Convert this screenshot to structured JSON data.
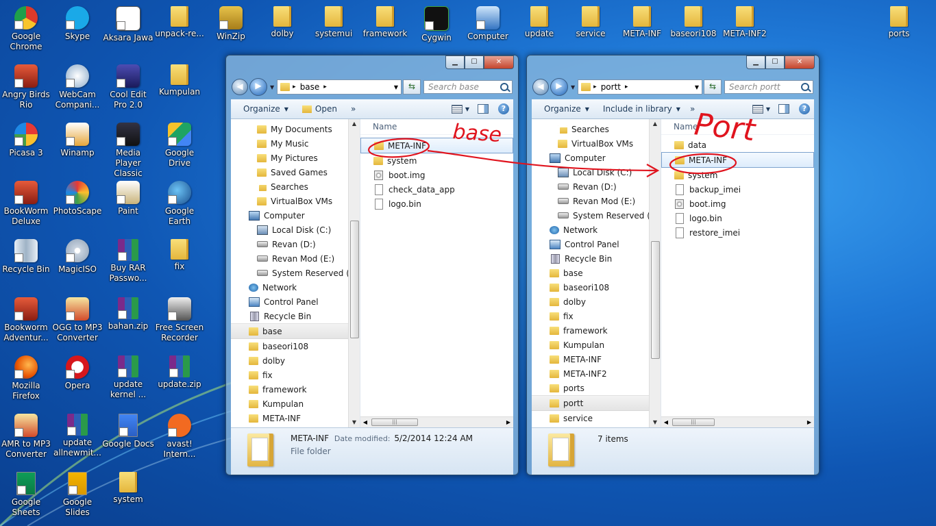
{
  "desktop_icons": [
    {
      "label": "Google Chrome",
      "icon": "chrome-icon"
    },
    {
      "label": "Skype",
      "icon": "skype-icon"
    },
    {
      "label": "Aksara Jawa",
      "icon": "app-icon"
    },
    {
      "label": "unpack-re...",
      "icon": "folder-icon"
    },
    {
      "label": "WinZip",
      "icon": "winzip-icon"
    },
    {
      "label": "dolby",
      "icon": "folder-icon"
    },
    {
      "label": "systemui",
      "icon": "folder-icon"
    },
    {
      "label": "framework",
      "icon": "folder-icon"
    },
    {
      "label": "Cygwin",
      "icon": "terminal-icon"
    },
    {
      "label": "Computer",
      "icon": "computer-icon"
    },
    {
      "label": "update",
      "icon": "folder-icon"
    },
    {
      "label": "service",
      "icon": "folder-icon"
    },
    {
      "label": "META-INF",
      "icon": "folder-icon"
    },
    {
      "label": "baseori108",
      "icon": "folder-icon"
    },
    {
      "label": "META-INF2",
      "icon": "folder-icon"
    },
    {
      "label": "ports",
      "icon": "folder-icon"
    },
    {
      "label": "Angry Birds Rio",
      "icon": "game-icon"
    },
    {
      "label": "WebCam Compani...",
      "icon": "webcam-icon"
    },
    {
      "label": "Cool Edit Pro 2.0",
      "icon": "audio-editor-icon"
    },
    {
      "label": "Kumpulan",
      "icon": "folder-icon"
    },
    {
      "label": "Picasa 3",
      "icon": "picasa-icon"
    },
    {
      "label": "Winamp",
      "icon": "winamp-icon"
    },
    {
      "label": "Media Player Classic",
      "icon": "media-player-icon"
    },
    {
      "label": "Google Drive",
      "icon": "google-drive-icon"
    },
    {
      "label": "BookWorm Deluxe",
      "icon": "game-icon"
    },
    {
      "label": "PhotoScape",
      "icon": "photoscape-icon"
    },
    {
      "label": "Paint",
      "icon": "paint-icon"
    },
    {
      "label": "Google Earth",
      "icon": "google-earth-icon"
    },
    {
      "label": "Recycle Bin",
      "icon": "recycle-bin-icon"
    },
    {
      "label": "MagicISO",
      "icon": "disc-icon"
    },
    {
      "label": "Buy RAR Passwo...",
      "icon": "rar-icon"
    },
    {
      "label": "fix",
      "icon": "folder-icon"
    },
    {
      "label": "Bookworm Adventur...",
      "icon": "game-icon"
    },
    {
      "label": "OGG to MP3 Converter",
      "icon": "converter-icon"
    },
    {
      "label": "bahan.zip",
      "icon": "rar-icon"
    },
    {
      "label": "Free Screen Recorder",
      "icon": "recorder-icon"
    },
    {
      "label": "Mozilla Firefox",
      "icon": "firefox-icon"
    },
    {
      "label": "Opera",
      "icon": "opera-icon"
    },
    {
      "label": "update kernel ...",
      "icon": "rar-icon"
    },
    {
      "label": "update.zip",
      "icon": "rar-icon"
    },
    {
      "label": "AMR to MP3 Converter",
      "icon": "converter-icon"
    },
    {
      "label": "update allnewmit...",
      "icon": "rar-icon"
    },
    {
      "label": "Google Docs",
      "icon": "google-docs-icon"
    },
    {
      "label": "avast! Intern...",
      "icon": "avast-icon"
    },
    {
      "label": "Google Sheets",
      "icon": "google-sheets-icon"
    },
    {
      "label": "Google Slides",
      "icon": "google-slides-icon"
    },
    {
      "label": "system",
      "icon": "folder-icon"
    }
  ],
  "window_left": {
    "path": "base",
    "search_placeholder": "Search base",
    "toolbar": {
      "organize": "Organize",
      "open": "Open",
      "more": "»"
    },
    "nav_items": [
      {
        "label": "My Documents",
        "icon": "folder"
      },
      {
        "label": "My Music",
        "icon": "folder"
      },
      {
        "label": "My Pictures",
        "icon": "folder"
      },
      {
        "label": "Saved Games",
        "icon": "folder"
      },
      {
        "label": "Searches",
        "icon": "search"
      },
      {
        "label": "VirtualBox VMs",
        "icon": "folder"
      },
      {
        "label": "Computer",
        "icon": "computer"
      },
      {
        "label": "Local Disk (C:)",
        "icon": "sysdrive"
      },
      {
        "label": "Revan (D:)",
        "icon": "drive"
      },
      {
        "label": "Revan Mod (E:)",
        "icon": "drive"
      },
      {
        "label": "System Reserved (F:)",
        "icon": "drive"
      },
      {
        "label": "Network",
        "icon": "network"
      },
      {
        "label": "Control Panel",
        "icon": "cpanel"
      },
      {
        "label": "Recycle Bin",
        "icon": "bin"
      },
      {
        "label": "base",
        "icon": "folder"
      },
      {
        "label": "baseori108",
        "icon": "folder"
      },
      {
        "label": "dolby",
        "icon": "folder"
      },
      {
        "label": "fix",
        "icon": "folder"
      },
      {
        "label": "framework",
        "icon": "folder"
      },
      {
        "label": "Kumpulan",
        "icon": "folder"
      },
      {
        "label": "META-INF",
        "icon": "folder"
      }
    ],
    "column_header": "Name",
    "files": [
      {
        "name": "META-INF",
        "type": "folder"
      },
      {
        "name": "system",
        "type": "folder"
      },
      {
        "name": "boot.img",
        "type": "img"
      },
      {
        "name": "check_data_app",
        "type": "file"
      },
      {
        "name": "logo.bin",
        "type": "file"
      }
    ],
    "details": {
      "name": "META-INF",
      "modified_label": "Date modified:",
      "modified_value": "5/2/2014 12:24 AM",
      "type": "File folder"
    }
  },
  "window_right": {
    "path": "portt",
    "search_placeholder": "Search portt",
    "toolbar": {
      "organize": "Organize",
      "include": "Include in library",
      "more": "»"
    },
    "nav_items": [
      {
        "label": "Searches",
        "icon": "search"
      },
      {
        "label": "VirtualBox VMs",
        "icon": "folder"
      },
      {
        "label": "Computer",
        "icon": "computer"
      },
      {
        "label": "Local Disk (C:)",
        "icon": "sysdrive"
      },
      {
        "label": "Revan (D:)",
        "icon": "drive"
      },
      {
        "label": "Revan Mod (E:)",
        "icon": "drive"
      },
      {
        "label": "System Reserved (F:)",
        "icon": "drive"
      },
      {
        "label": "Network",
        "icon": "network"
      },
      {
        "label": "Control Panel",
        "icon": "cpanel"
      },
      {
        "label": "Recycle Bin",
        "icon": "bin"
      },
      {
        "label": "base",
        "icon": "folder"
      },
      {
        "label": "baseori108",
        "icon": "folder"
      },
      {
        "label": "dolby",
        "icon": "folder"
      },
      {
        "label": "fix",
        "icon": "folder"
      },
      {
        "label": "framework",
        "icon": "folder"
      },
      {
        "label": "Kumpulan",
        "icon": "folder"
      },
      {
        "label": "META-INF",
        "icon": "folder"
      },
      {
        "label": "META-INF2",
        "icon": "folder"
      },
      {
        "label": "ports",
        "icon": "folder"
      },
      {
        "label": "portt",
        "icon": "folder"
      },
      {
        "label": "service",
        "icon": "folder"
      }
    ],
    "column_header": "Name",
    "files": [
      {
        "name": "data",
        "type": "folder"
      },
      {
        "name": "META-INF",
        "type": "folder"
      },
      {
        "name": "system",
        "type": "folder"
      },
      {
        "name": "backup_imei",
        "type": "file"
      },
      {
        "name": "boot.img",
        "type": "img"
      },
      {
        "name": "logo.bin",
        "type": "file"
      },
      {
        "name": "restore_imei",
        "type": "file"
      }
    ],
    "details": {
      "count": "7 items"
    }
  },
  "annotations": {
    "left_label": "base",
    "right_label": "Port",
    "color": "#e0141e"
  }
}
